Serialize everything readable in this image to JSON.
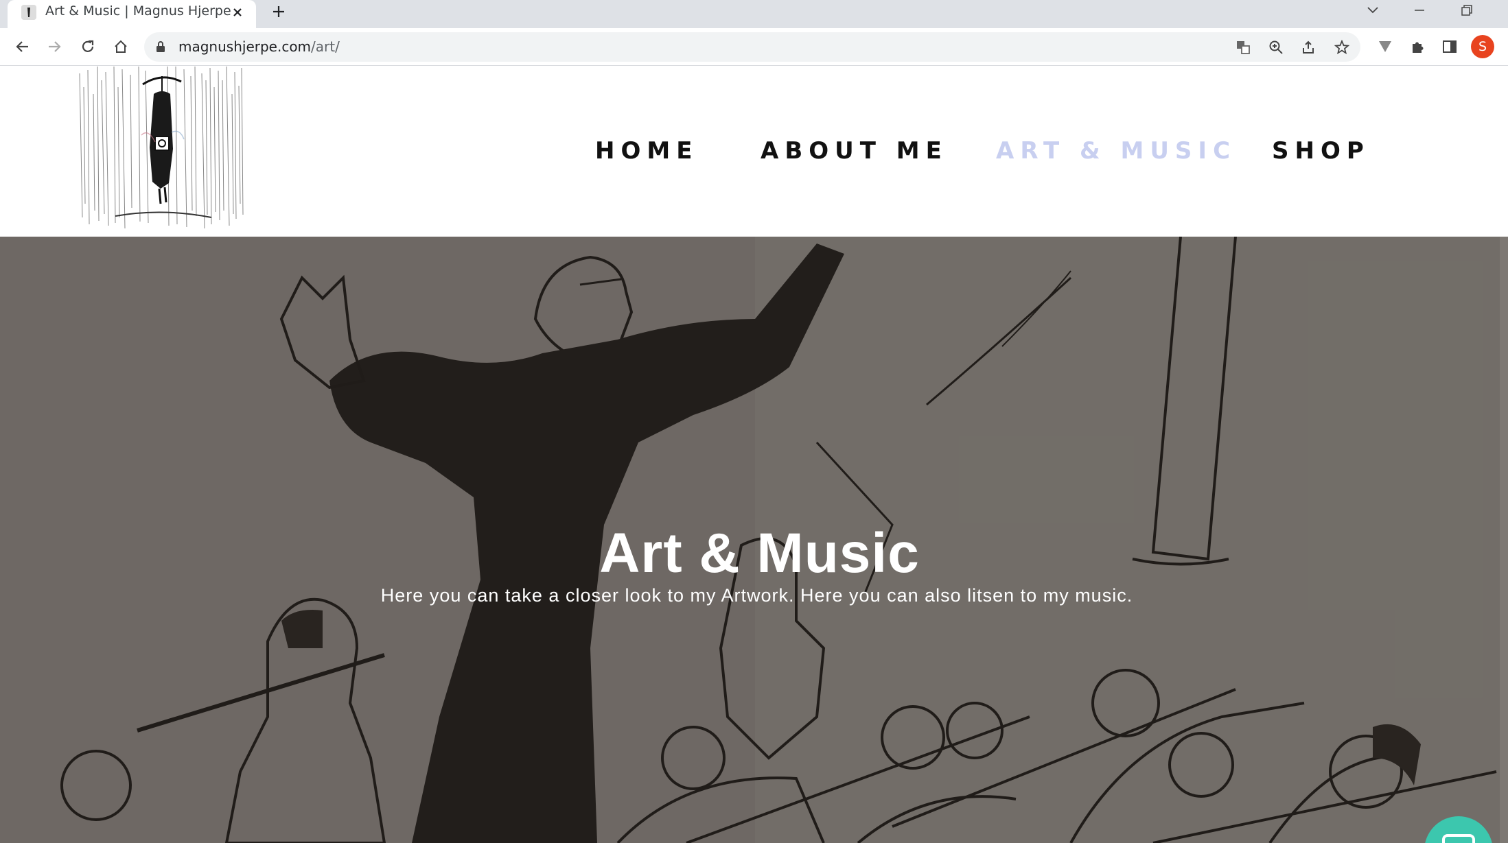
{
  "browser": {
    "tab": {
      "title": "Art & Music | Magnus Hjerpe"
    },
    "address": {
      "domain": "magnushjerpe.com",
      "path": "/art/"
    },
    "profile_initial": "S"
  },
  "nav": {
    "items": [
      {
        "label": "HOME",
        "active": false
      },
      {
        "label": "ABOUT ME",
        "active": false
      },
      {
        "label": "ART & MUSIC",
        "active": true
      },
      {
        "label": "SHOP",
        "active": false
      }
    ],
    "active_color": "#c8cff0"
  },
  "hero": {
    "title": "Art & Music",
    "subtitle": "Here you can take a closer look to my Artwork. Here you can also litsen to my music."
  },
  "colors": {
    "chat_accent": "#3cc7ae",
    "avatar": "#e8431f"
  }
}
